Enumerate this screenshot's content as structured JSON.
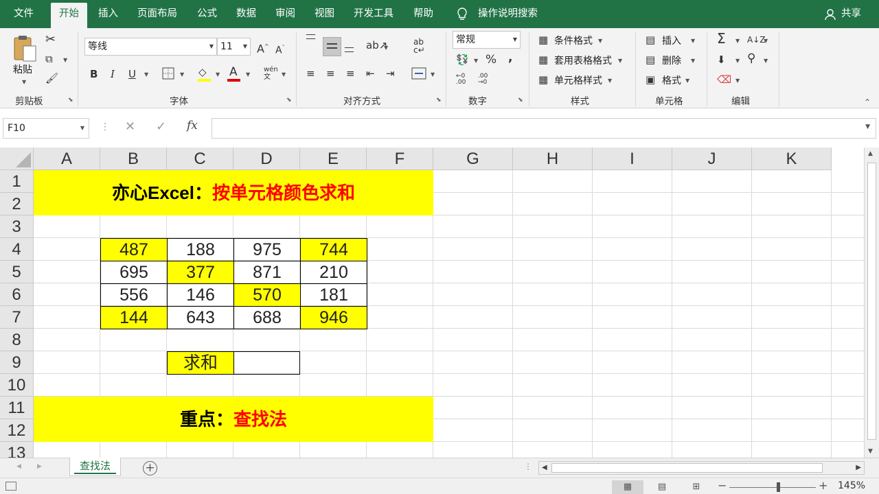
{
  "menu": {
    "tabs": [
      "文件",
      "开始",
      "插入",
      "页面布局",
      "公式",
      "数据",
      "审阅",
      "视图",
      "开发工具",
      "帮助"
    ],
    "active_tab": "开始",
    "tell_me": "操作说明搜索",
    "share": "共享"
  },
  "ribbon": {
    "clipboard": {
      "paste": "粘贴",
      "group": "剪贴板"
    },
    "font": {
      "name": "等线",
      "size": "11",
      "bold": "B",
      "italic": "I",
      "underline": "U",
      "grow": "A",
      "shrink": "A",
      "font_color": "A",
      "phonetic": "wén",
      "group": "字体"
    },
    "alignment": {
      "group": "对齐方式"
    },
    "number": {
      "format": "常规",
      "percent": "%",
      "comma": ",",
      "group": "数字"
    },
    "styles": {
      "conditional": "条件格式",
      "table": "套用表格格式",
      "cell_styles": "单元格样式",
      "group": "样式"
    },
    "cells": {
      "insert": "插入",
      "delete": "删除",
      "format": "格式",
      "group": "单元格"
    },
    "editing": {
      "sum": "Σ",
      "group": "编辑"
    }
  },
  "formula_bar": {
    "name_box": "F10",
    "fx": "fx",
    "formula": ""
  },
  "sheet": {
    "columns": [
      "A",
      "B",
      "C",
      "D",
      "E",
      "F",
      "G",
      "H",
      "I",
      "J",
      "K"
    ],
    "rows": [
      "1",
      "2",
      "3",
      "4",
      "5",
      "6",
      "7",
      "8",
      "9",
      "10",
      "11",
      "12",
      "13"
    ],
    "title_black": "亦心Excel：",
    "title_red": "按单元格颜色求和",
    "table": [
      [
        "487",
        "188",
        "975",
        "744"
      ],
      [
        "695",
        "377",
        "871",
        "210"
      ],
      [
        "556",
        "146",
        "570",
        "181"
      ],
      [
        "144",
        "643",
        "688",
        "946"
      ]
    ],
    "highlight": [
      [
        true,
        false,
        false,
        true
      ],
      [
        false,
        true,
        false,
        false
      ],
      [
        false,
        false,
        true,
        false
      ],
      [
        true,
        false,
        false,
        true
      ]
    ],
    "sum_label": "求和",
    "sum_value": "",
    "footer_black": "重点：",
    "footer_red": "查找法"
  },
  "tabs": {
    "sheet_name": "查找法"
  },
  "status": {
    "zoom": "145%"
  },
  "colors": {
    "accent": "#217346",
    "highlight": "#ffff00",
    "red": "#ff0000"
  }
}
